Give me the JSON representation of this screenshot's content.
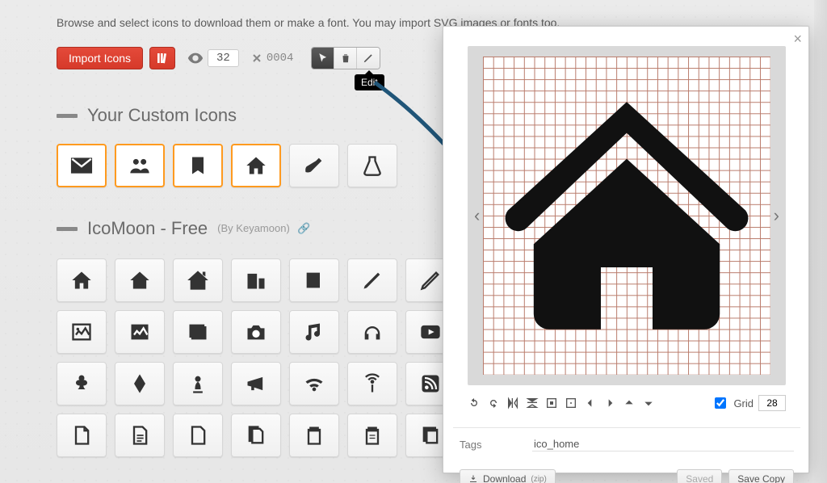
{
  "instruction": "Browse and select icons to download them or make a font. You may import SVG images or fonts too.",
  "toolbar": {
    "import_label": "Import Icons",
    "visible_count": "32",
    "removed_count": "0004",
    "edit_tooltip": "Edit"
  },
  "sections": {
    "custom_title": "Your Custom Icons",
    "icomoon_title": "IcoMoon - Free",
    "by_label": "(By",
    "by_author": "Keyamoon",
    "by_close": ")"
  },
  "editor": {
    "tags_label": "Tags",
    "tags_value": "ico_home",
    "grid_label": "Grid",
    "grid_value": "28",
    "download_label": "Download",
    "download_hint": "(zip)",
    "saved_label": "Saved",
    "savecopy_label": "Save Copy"
  }
}
